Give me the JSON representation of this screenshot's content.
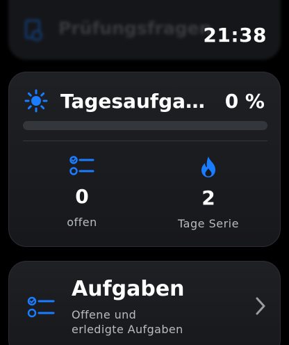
{
  "top_card": {
    "title": "Prüfungsfragen"
  },
  "status": {
    "time": "21:38"
  },
  "daily": {
    "title": "Tagesaufga…",
    "percent_label": "0 %",
    "progress": 0,
    "open_count": "0",
    "open_label": "offen",
    "streak_count": "2",
    "streak_label": "Tage Serie"
  },
  "tasks": {
    "title": "Aufgaben",
    "subtitle_line1": "Offene und",
    "subtitle_line2": "erledigte Aufgaben"
  },
  "colors": {
    "accent": "#1a7cff",
    "background": "#000000",
    "card": "#1c1e22"
  },
  "icons": [
    "document-search-icon",
    "sun-icon",
    "checklist-icon",
    "flame-icon",
    "chevron-right-icon"
  ]
}
